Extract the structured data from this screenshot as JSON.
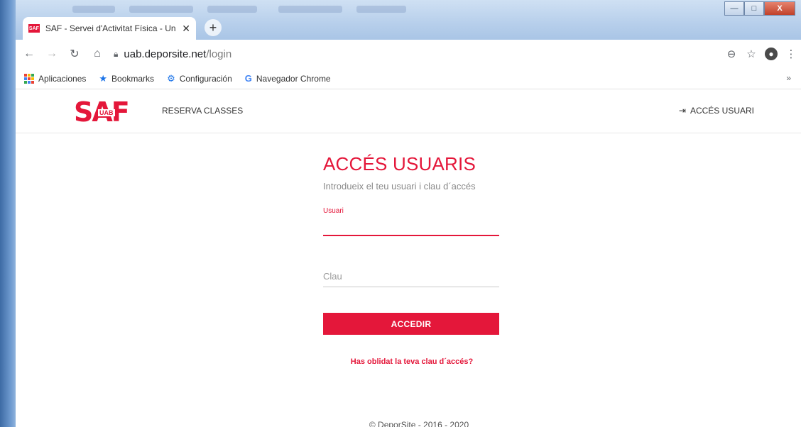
{
  "browser": {
    "tab_title": "SAF - Servei d'Activitat Física - Un",
    "favicon_label": "SAF",
    "tab_close": "✕",
    "new_tab": "+",
    "url_host": "uab.deporsite.net",
    "url_path": "/login",
    "window_buttons": {
      "minimize": "—",
      "maximize": "□",
      "close": "X"
    }
  },
  "bookmarks": [
    {
      "label": "Aplicaciones",
      "icon": "apps-grid-icon"
    },
    {
      "label": "Bookmarks",
      "icon": "star-icon"
    },
    {
      "label": "Configuración",
      "icon": "gear-icon"
    },
    {
      "label": "Navegador Chrome",
      "icon": "google-icon"
    }
  ],
  "bookmarks_more": "»",
  "site": {
    "logo_text": "SAF",
    "logo_sub": "UAB",
    "nav_reserva": "RESERVA CLASSES",
    "nav_acces": "ACCÉS USUARI"
  },
  "login": {
    "title": "ACCÉS USUARIS",
    "subtitle": "Introdueix el teu usuari i clau d´accés",
    "user_label": "Usuari",
    "user_value": "",
    "password_placeholder": "Clau",
    "submit_label": "ACCEDIR",
    "forgot_link": "Has oblidat la teva clau d´accés?"
  },
  "footer": "© DeporSite - 2016 - 2020",
  "colors": {
    "accent": "#e4173a",
    "window_frame": "#b7cfeb"
  }
}
